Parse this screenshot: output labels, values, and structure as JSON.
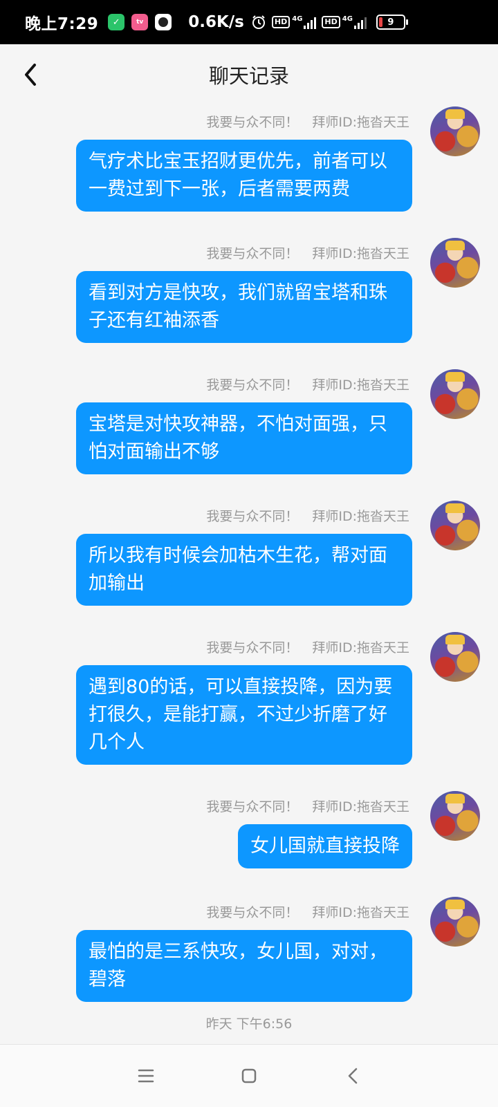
{
  "status_bar": {
    "time": "晚上7:29",
    "net_speed": "0.6K/s",
    "hd_label": "HD",
    "net_type": "4G",
    "battery": "9",
    "icons": [
      "shield-app-icon",
      "bilibili-app-icon",
      "camera-app-icon",
      "alarm-icon",
      "signal-icon",
      "battery-icon"
    ],
    "colors": {
      "battery_low": "#e84545"
    }
  },
  "header": {
    "title": "聊天记录",
    "back_icon": "chevron-left-icon"
  },
  "messages": [
    {
      "sender": "我要与众不同！",
      "master_id": "拜师ID:拖沓天王",
      "text": "气疗术比宝玉招财更优先，前者可以一费过到下一张，后者需要两费"
    },
    {
      "sender": "我要与众不同！",
      "master_id": "拜师ID:拖沓天王",
      "text": "看到对方是快攻，我们就留宝塔和珠子还有红袖添香"
    },
    {
      "sender": "我要与众不同！",
      "master_id": "拜师ID:拖沓天王",
      "text": "宝塔是对快攻神器，不怕对面强，只怕对面输出不够"
    },
    {
      "sender": "我要与众不同！",
      "master_id": "拜师ID:拖沓天王",
      "text": "所以我有时候会加枯木生花，帮对面加输出"
    },
    {
      "sender": "我要与众不同！",
      "master_id": "拜师ID:拖沓天王",
      "text": "遇到80的话，可以直接投降，因为要打很久，是能打赢，不过少折磨了好几个人"
    },
    {
      "sender": "我要与众不同！",
      "master_id": "拜师ID:拖沓天王",
      "text": "女儿国就直接投降"
    },
    {
      "sender": "我要与众不同！",
      "master_id": "拜师ID:拖沓天王",
      "text": "最怕的是三系快攻，女儿国，对对，碧落"
    }
  ],
  "timestamp": "昨天 下午6:56",
  "nav": {
    "menu_icon": "menu-icon",
    "home_icon": "home-square-icon",
    "back_icon": "back-triangle-icon"
  },
  "colors": {
    "bubble": "#0d97ff",
    "background": "#f5f5f5",
    "meta_text": "#999999"
  }
}
